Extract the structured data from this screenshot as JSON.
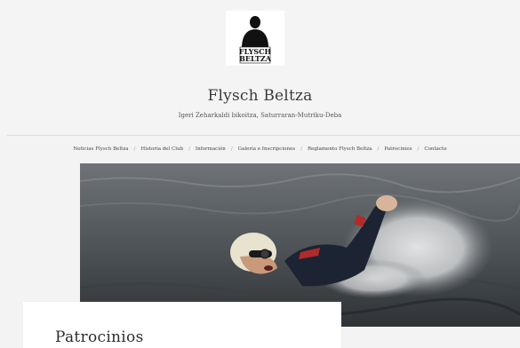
{
  "site": {
    "title": "Flysch Beltza",
    "tagline": "Igeri Zeharkaldi bikoitza, Saturraran-Mutriku-Deba",
    "logo_text_line1": "FLYSCH",
    "logo_text_line2": "BELTZA"
  },
  "nav": {
    "items": [
      {
        "label": "Noticias Flysch Beltza"
      },
      {
        "label": "Historia del Club"
      },
      {
        "label": "Información"
      },
      {
        "label": "Galería e Inscripciones"
      },
      {
        "label": "Reglamento Flysch Beltza"
      },
      {
        "label": "Patrocinios"
      },
      {
        "label": "Contacto"
      }
    ],
    "separator": "/"
  },
  "hero": {
    "subject": "swimmer in wetsuit with cap and goggles, open-water crawl stroke"
  },
  "main": {
    "page_title": "Patrocinios"
  }
}
